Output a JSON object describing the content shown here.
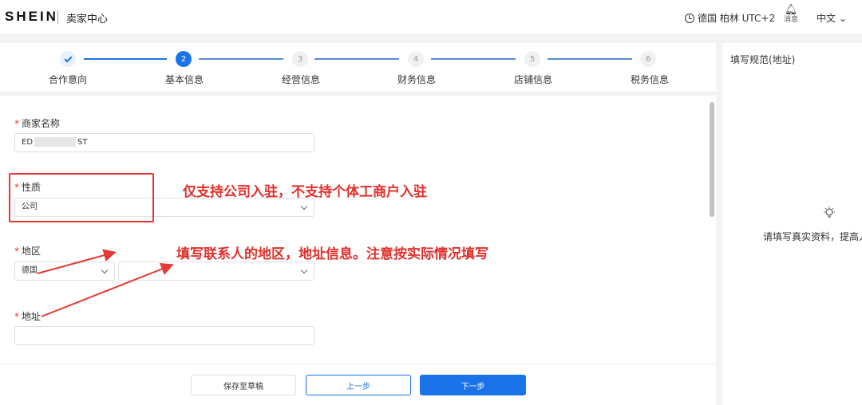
{
  "header": {
    "logo": "SHEIN",
    "app_name": "卖家中心",
    "timezone": "德国 柏林 UTC+2",
    "messages_label": "消息",
    "language": "中文"
  },
  "steps": [
    {
      "number": "1",
      "label": "合作意向",
      "state": "done"
    },
    {
      "number": "2",
      "label": "基本信息",
      "state": "active"
    },
    {
      "number": "3",
      "label": "经营信息",
      "state": "todo"
    },
    {
      "number": "4",
      "label": "财务信息",
      "state": "todo"
    },
    {
      "number": "5",
      "label": "店铺信息",
      "state": "todo"
    },
    {
      "number": "6",
      "label": "税务信息",
      "state": "todo"
    }
  ],
  "form": {
    "merchant_name_label": "商家名称",
    "merchant_name_prefix": "ED",
    "merchant_name_suffix": "ST",
    "nature_label": "性质",
    "nature_value": "公司",
    "region_label": "地区",
    "region_value": "德国",
    "address_label": "地址",
    "address_value": "",
    "required_mark": "*"
  },
  "annotations": {
    "nature_note": "仅支持公司入驻，不支持个体工商户入驻",
    "region_note": "填写联系人的地区，地址信息。注意按实际情况填写"
  },
  "footer": {
    "save_draft": "保存至草稿",
    "prev_step": "上一步",
    "next_step": "下一步"
  },
  "side_panel": {
    "title": "填写规范(地址)",
    "hint": "请填写真实资料，提高入"
  },
  "colors": {
    "accent": "#1a73e8",
    "annotation": "#e53935"
  }
}
